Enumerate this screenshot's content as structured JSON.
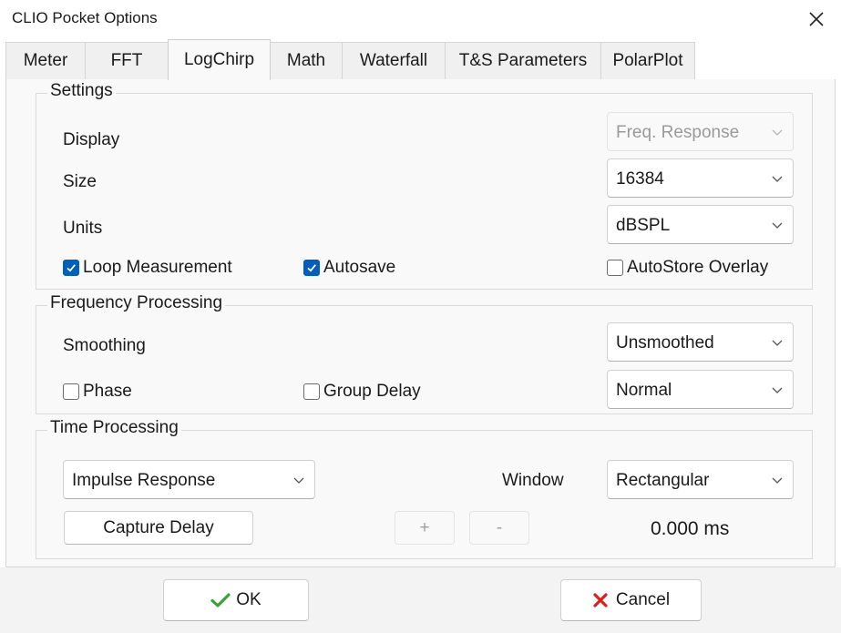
{
  "window": {
    "title": "CLIO Pocket Options"
  },
  "tabs": [
    {
      "label": "Meter"
    },
    {
      "label": "FFT"
    },
    {
      "label": "LogChirp"
    },
    {
      "label": "Math"
    },
    {
      "label": "Waterfall"
    },
    {
      "label": "T&S Parameters"
    },
    {
      "label": "PolarPlot"
    }
  ],
  "active_tab": "LogChirp",
  "settings": {
    "legend": "Settings",
    "display_label": "Display",
    "display_value": "Freq. Response",
    "display_enabled": false,
    "size_label": "Size",
    "size_value": "16384",
    "units_label": "Units",
    "units_value": "dBSPL",
    "loop_measurement": {
      "label": "Loop Measurement",
      "checked": true
    },
    "autosave": {
      "label": "Autosave",
      "checked": true
    },
    "autostore_overlay": {
      "label": "AutoStore Overlay",
      "checked": false
    }
  },
  "frequency_processing": {
    "legend": "Frequency Processing",
    "smoothing_label": "Smoothing",
    "smoothing_value": "Unsmoothed",
    "phase": {
      "label": "Phase",
      "checked": false
    },
    "group_delay": {
      "label": "Group Delay",
      "checked": false
    },
    "mode_value": "Normal"
  },
  "time_processing": {
    "legend": "Time Processing",
    "type_value": "Impulse Response",
    "window_label": "Window",
    "window_value": "Rectangular",
    "capture_delay_label": "Capture Delay",
    "plus_label": "+",
    "minus_label": "-",
    "delay_readout": "0.000 ms"
  },
  "footer": {
    "ok_label": "OK",
    "cancel_label": "Cancel"
  },
  "colors": {
    "accent": "#005fb8",
    "ok_icon": "#3aa335",
    "cancel_icon": "#d9201f"
  },
  "icons": {
    "close": "close-icon",
    "chevron": "chevron-down-icon",
    "check": "checkmark-icon",
    "ok": "green-check-icon",
    "cancel": "red-x-icon"
  }
}
